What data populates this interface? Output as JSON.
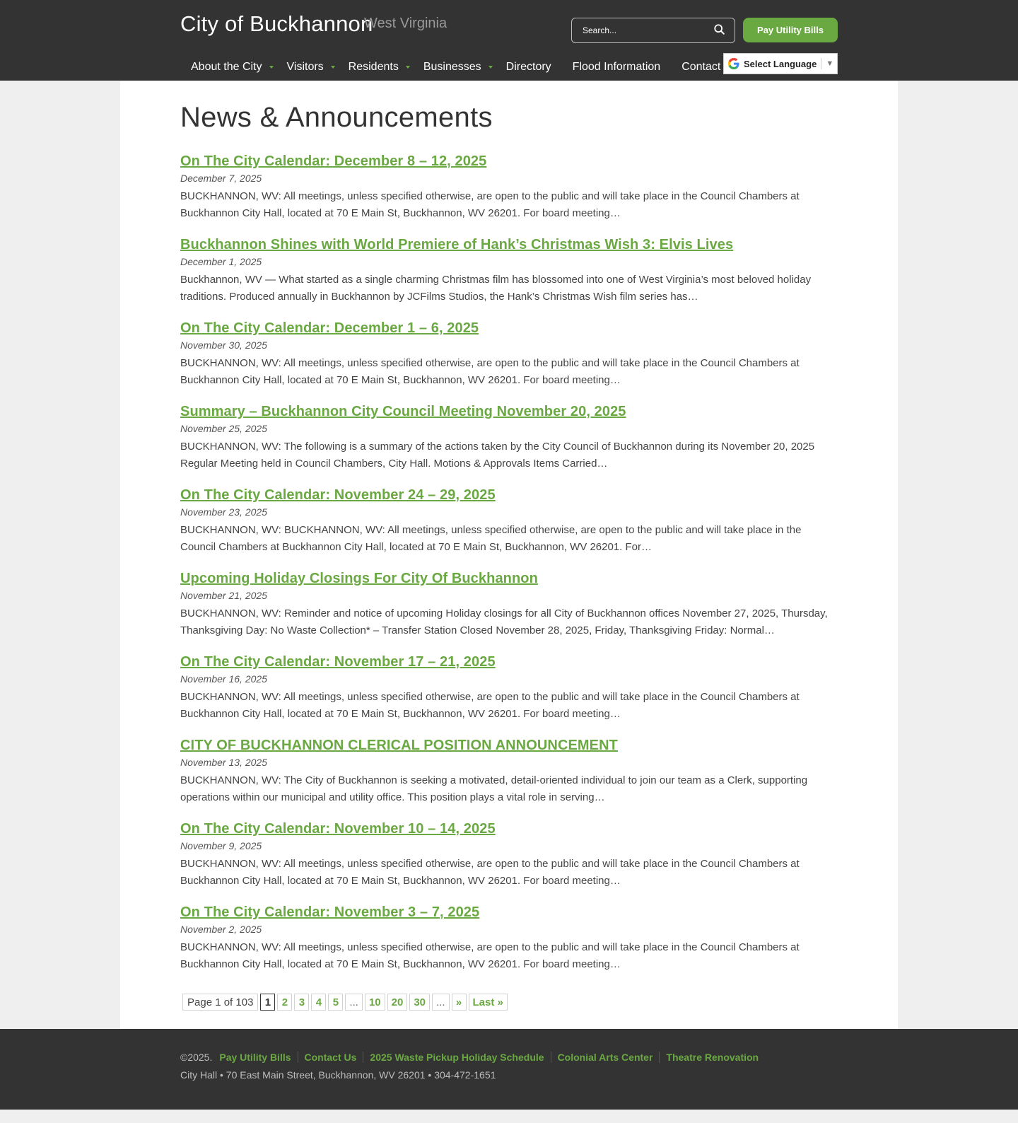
{
  "header": {
    "site_title": "City of Buckhannon",
    "site_subtitle": "West Virginia",
    "search_placeholder": "Search...",
    "pay_button": "Pay Utility Bills",
    "language_label": "Select Language",
    "nav": [
      {
        "label": "About the City",
        "has_submenu": true
      },
      {
        "label": "Visitors",
        "has_submenu": true
      },
      {
        "label": "Residents",
        "has_submenu": true
      },
      {
        "label": "Businesses",
        "has_submenu": true
      },
      {
        "label": "Directory",
        "has_submenu": false
      },
      {
        "label": "Flood Information",
        "has_submenu": false
      },
      {
        "label": "Contact Us",
        "has_submenu": false
      }
    ]
  },
  "main": {
    "page_title": "News & Announcements",
    "posts": [
      {
        "title": "On The City Calendar: December 8 – 12, 2025",
        "date": "December 7, 2025",
        "excerpt": "BUCKHANNON, WV: All meetings, unless specified otherwise, are open to the public and will take place in the Council Chambers at Buckhannon City Hall, located at 70 E Main St, Buckhannon, WV 26201. For board meeting…"
      },
      {
        "title": "Buckhannon Shines with World Premiere of Hank’s Christmas Wish 3: Elvis Lives",
        "date": "December 1, 2025",
        "excerpt": "Buckhannon, WV — What started as a single charming Christmas film has blossomed into one of West Virginia’s most beloved holiday traditions. Produced annually in Buckhannon by JCFilms Studios, the Hank’s Christmas Wish film series has…"
      },
      {
        "title": "On The City Calendar: December 1 – 6, 2025",
        "date": "November 30, 2025",
        "excerpt": "BUCKHANNON, WV: All meetings, unless specified otherwise, are open to the public and will take place in the Council Chambers at Buckhannon City Hall, located at 70 E Main St, Buckhannon, WV 26201. For board meeting…"
      },
      {
        "title": "Summary – Buckhannon City Council Meeting November 20, 2025",
        "date": "November 25, 2025",
        "excerpt": "BUCKHANNON, WV: The following is a summary of the actions taken by the City Council of Buckhannon during its November 20, 2025 Regular Meeting held in Council Chambers, City Hall. Motions & Approvals Items Carried…"
      },
      {
        "title": "On The City Calendar: November 24 – 29, 2025",
        "date": "November 23, 2025",
        "excerpt": "BUCKHANNON, WV: BUCKHANNON, WV: All meetings, unless specified otherwise, are open to the public and will take place in the Council Chambers at Buckhannon City Hall, located at 70 E Main St, Buckhannon, WV 26201. For…"
      },
      {
        "title": "Upcoming Holiday Closings For City Of Buckhannon",
        "date": "November 21, 2025",
        "excerpt": "BUCKHANNON, WV: Reminder and notice of upcoming Holiday closings for all City of Buckhannon offices November 27, 2025, Thursday, Thanksgiving Day: No Waste Collection* – Transfer Station Closed November 28, 2025, Friday, Thanksgiving Friday: Normal…"
      },
      {
        "title": "On The City Calendar: November 17 – 21, 2025",
        "date": "November 16, 2025",
        "excerpt": "BUCKHANNON, WV: All meetings, unless specified otherwise, are open to the public and will take place in the Council Chambers at Buckhannon City Hall, located at 70 E Main St, Buckhannon, WV 26201. For board meeting…"
      },
      {
        "title": "CITY OF BUCKHANNON CLERICAL POSITION ANNOUNCEMENT",
        "date": "November 13, 2025",
        "excerpt": "BUCKHANNON, WV: The City of Buckhannon is seeking a motivated, detail-oriented individual to join our team as a Clerk, supporting operations within our municipal and utility office. This position plays a vital role in serving…"
      },
      {
        "title": "On The City Calendar: November 10 – 14, 2025",
        "date": "November 9, 2025",
        "excerpt": "BUCKHANNON, WV: All meetings, unless specified otherwise, are open to the public and will take place in the Council Chambers at Buckhannon City Hall, located at 70 E Main St, Buckhannon, WV 26201. For board meeting…"
      },
      {
        "title": "On The City Calendar: November 3 – 7, 2025",
        "date": "November 2, 2025",
        "excerpt": "BUCKHANNON, WV: All meetings, unless specified otherwise, are open to the public and will take place in the Council Chambers at Buckhannon City Hall, located at 70 E Main St, Buckhannon, WV 26201. For board meeting…"
      }
    ],
    "pagination": {
      "info": "Page 1 of 103",
      "current": "1",
      "pages": [
        "2",
        "3",
        "4",
        "5"
      ],
      "ellipsis": "...",
      "jumps": [
        "10",
        "20",
        "30"
      ],
      "next": "»",
      "last": "Last »"
    }
  },
  "footer": {
    "copyright": "©2025.",
    "links": [
      "Pay Utility Bills",
      "Contact Us",
      "2025 Waste Pickup Holiday Schedule",
      "Colonial Arts Center",
      "Theatre Renovation"
    ],
    "address": "City Hall • 70 East Main Street, Buckhannon, WV 26201 • 304-472-1651"
  },
  "colors": {
    "accent": "#6aa842",
    "header_bg": "#333333",
    "page_bg": "#efefef"
  }
}
